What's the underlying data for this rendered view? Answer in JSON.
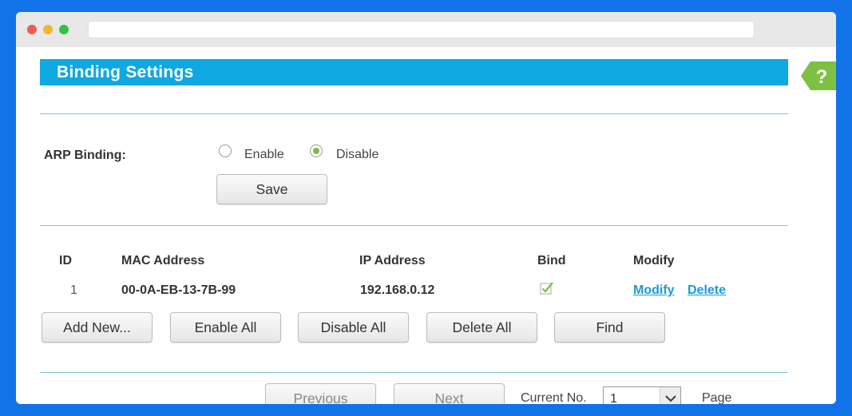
{
  "page": {
    "title": "Binding Settings"
  },
  "arp": {
    "label": "ARP Binding:",
    "enable_label": "Enable",
    "disable_label": "Disable",
    "selected": "Disable",
    "save_label": "Save"
  },
  "table": {
    "headers": [
      "ID",
      "MAC Address",
      "IP Address",
      "Bind",
      "Modify"
    ],
    "rows": [
      {
        "id": "1",
        "mac": "00-0A-EB-13-7B-99",
        "ip": "192.168.0.12",
        "bind": true,
        "modify_label": "Modify",
        "delete_label": "Delete"
      }
    ]
  },
  "actions": {
    "add_new": "Add New...",
    "enable_all": "Enable All",
    "disable_all": "Disable All",
    "delete_all": "Delete All",
    "find": "Find"
  },
  "pagination": {
    "previous": "Previous",
    "next": "Next",
    "current_label": "Current No.",
    "current_value": "1",
    "page_label": "Page"
  },
  "help": {
    "icon": "question-icon"
  },
  "colors": {
    "background": "#1272e8",
    "title_bar": "#0fa8e0",
    "link": "#1c9bd6",
    "help_tab": "#7dc142",
    "radio_checked": "#7dbb47"
  }
}
